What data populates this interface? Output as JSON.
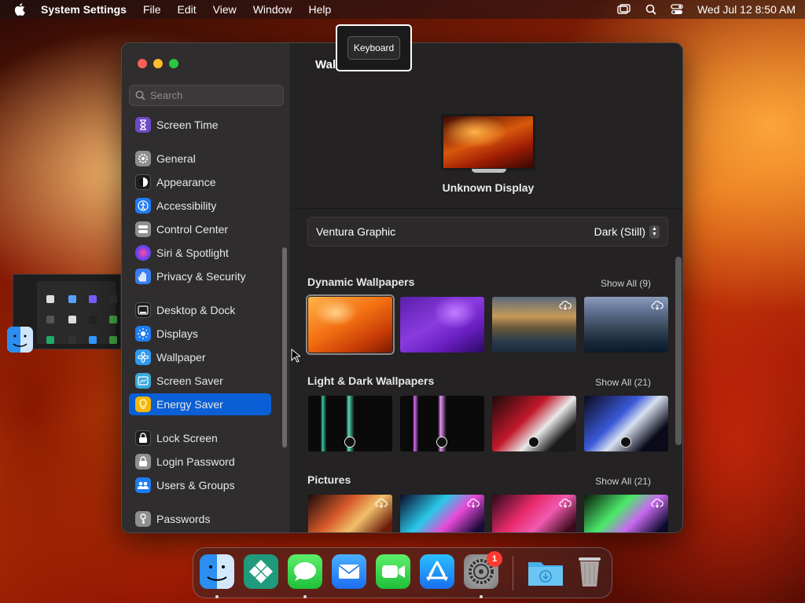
{
  "menubar": {
    "app_name": "System Settings",
    "menus": [
      "File",
      "Edit",
      "View",
      "Window",
      "Help"
    ],
    "clock": "Wed Jul 12  8:50 AM"
  },
  "sidebar": {
    "search_placeholder": "Search",
    "items": [
      {
        "label": "Screen Time",
        "icon": "hourglass-icon",
        "color": "#6e4ac7"
      },
      {
        "label": "General",
        "icon": "gear-icon",
        "color": "#8e8e93"
      },
      {
        "label": "Appearance",
        "icon": "appearance-icon",
        "color": "#1c1c1e"
      },
      {
        "label": "Accessibility",
        "icon": "accessibility-icon",
        "color": "#1e7cf2"
      },
      {
        "label": "Control Center",
        "icon": "control-center-icon",
        "color": "#8e8e93"
      },
      {
        "label": "Siri & Spotlight",
        "icon": "siri-icon",
        "color": "#b04ad8"
      },
      {
        "label": "Privacy & Security",
        "icon": "hand-icon",
        "color": "#3a7df0"
      },
      {
        "label": "Desktop & Dock",
        "icon": "dock-icon",
        "color": "#1c1c1e"
      },
      {
        "label": "Displays",
        "icon": "sun-icon",
        "color": "#1e7cf2"
      },
      {
        "label": "Wallpaper",
        "icon": "flower-icon",
        "color": "#2f9bf2"
      },
      {
        "label": "Screen Saver",
        "icon": "screen-saver-icon",
        "color": "#3aa8d8"
      },
      {
        "label": "Energy Saver",
        "icon": "bulb-icon",
        "color": "#f5b700"
      },
      {
        "label": "Lock Screen",
        "icon": "lock-icon",
        "color": "#1c1c1e"
      },
      {
        "label": "Login Password",
        "icon": "key-lock-icon",
        "color": "#8e8e93"
      },
      {
        "label": "Users & Groups",
        "icon": "users-icon",
        "color": "#1e7cf2"
      },
      {
        "label": "Passwords",
        "icon": "key-icon",
        "color": "#8e8e93"
      }
    ],
    "selected": "Energy Saver"
  },
  "main": {
    "title": "Wall",
    "display_name": "Unknown Display",
    "wallpaper_name": "Ventura Graphic",
    "wallpaper_mode": "Dark (Still)",
    "sections": [
      {
        "title": "Dynamic Wallpapers",
        "show_all": "Show All (9)"
      },
      {
        "title": "Light & Dark Wallpapers",
        "show_all": "Show All (21)"
      },
      {
        "title": "Pictures",
        "show_all": "Show All (21)"
      }
    ]
  },
  "tooltip": {
    "label": "Keyboard"
  },
  "dock": {
    "apps": [
      "Finder",
      "Xcode Helper",
      "Messages",
      "Mail",
      "FaceTime",
      "App Store",
      "System Settings",
      "Downloads",
      "Trash"
    ],
    "settings_badge": "1"
  },
  "colors": {
    "accent": "#0a5fd6",
    "window_bg": "#262626",
    "sidebar_bg": "#2f2d2e"
  }
}
